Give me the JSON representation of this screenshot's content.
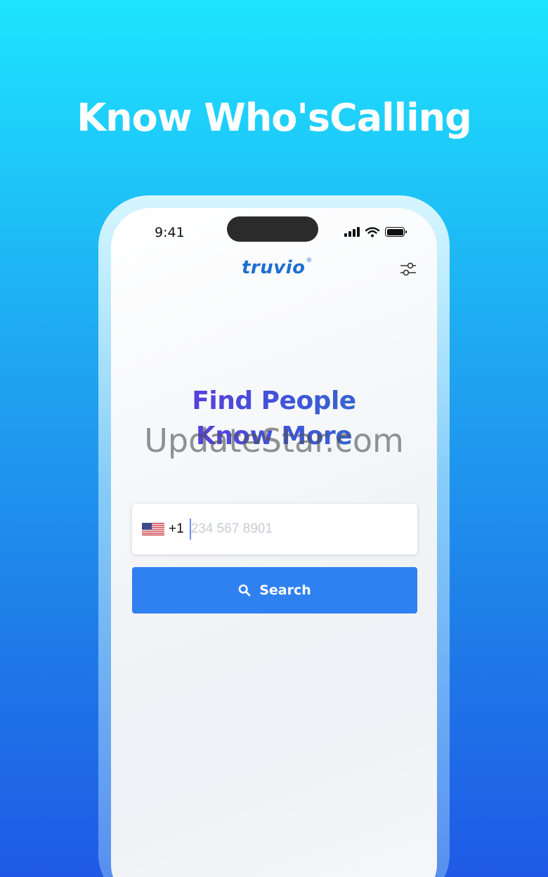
{
  "headline": "Know Who'sCalling",
  "status_bar": {
    "time": "9:41",
    "icons": [
      "signal-icon",
      "wifi-icon",
      "battery-icon"
    ]
  },
  "app": {
    "logo": "truvio",
    "logo_mark": "®",
    "filter_icon": "sliders-icon",
    "hero_line1": "Find People",
    "hero_line2": "Know More"
  },
  "phone_input": {
    "country_flag": "us-flag-icon",
    "dial_code": "+1",
    "placeholder": "234 567 8901",
    "value": ""
  },
  "search_button": {
    "icon": "search-icon",
    "label": "Search"
  },
  "watermark": "UpdateStar.com",
  "colors": {
    "bg_top": "#1de4ff",
    "bg_bottom": "#1f5ae6",
    "brand": "#1f6fd1",
    "button": "#2f80f0",
    "hero_start": "#6b2fe0",
    "hero_end": "#2a77c8"
  }
}
